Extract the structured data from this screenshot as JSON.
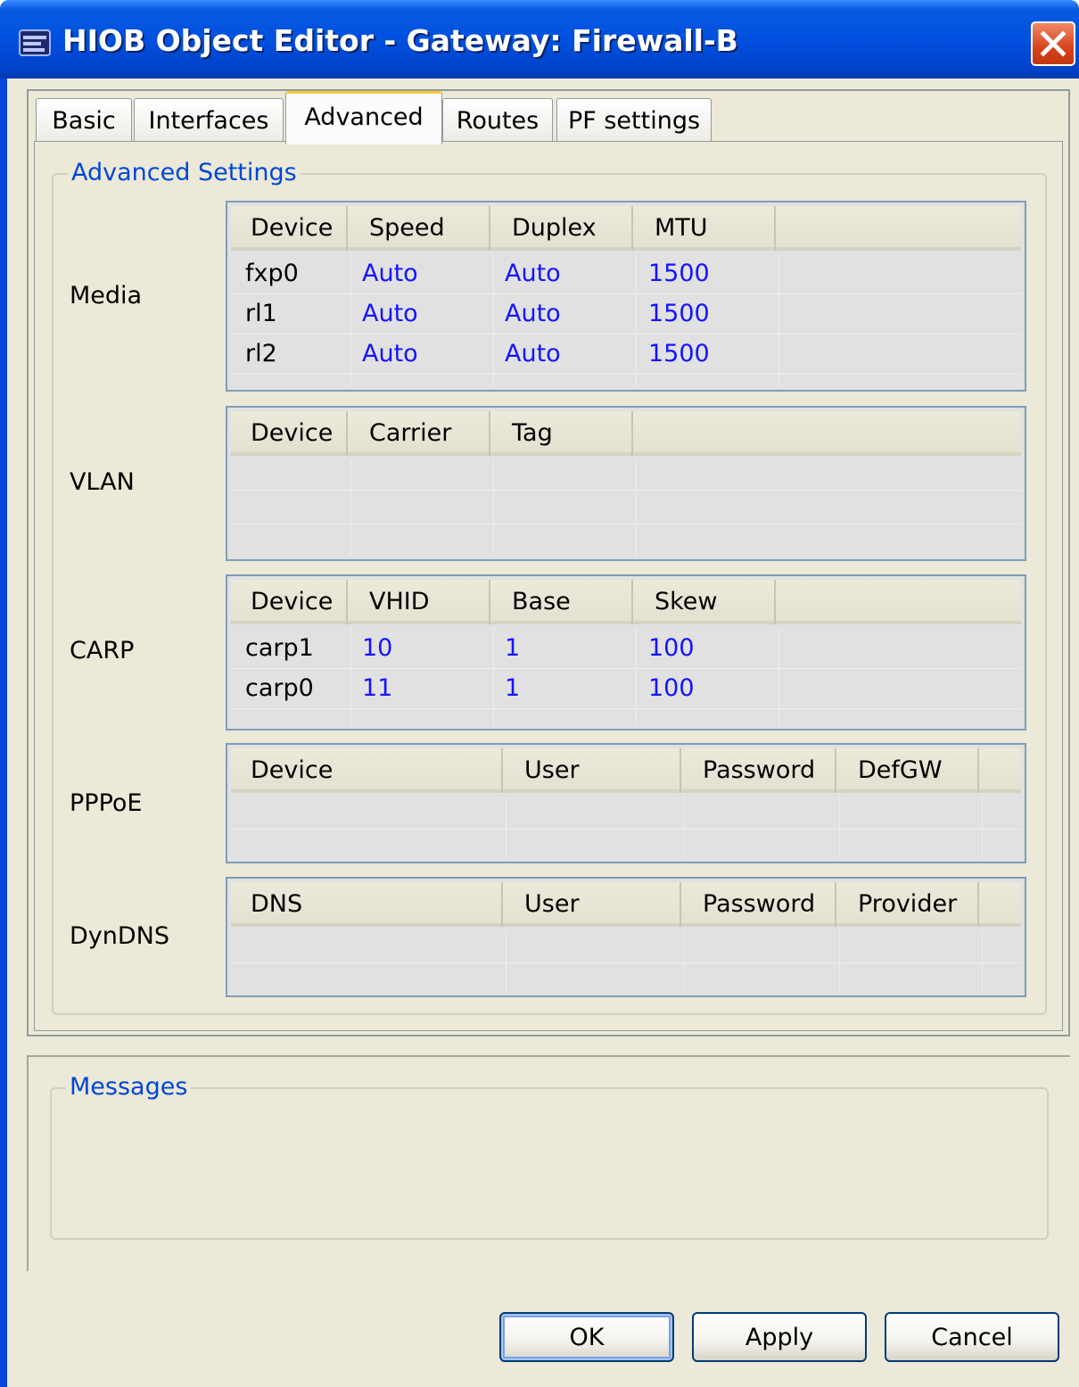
{
  "window": {
    "title": "HIOB Object Editor - Gateway: Firewall-B",
    "icon": "hiob-app-icon",
    "close_icon": "close-icon"
  },
  "tabs": [
    {
      "label": "Basic",
      "active": false
    },
    {
      "label": "Interfaces",
      "active": false
    },
    {
      "label": "Advanced",
      "active": true
    },
    {
      "label": "Routes",
      "active": false
    },
    {
      "label": "PF settings",
      "active": false
    }
  ],
  "advanced": {
    "legend": "Advanced Settings",
    "media": {
      "label": "Media",
      "columns": [
        "Device",
        "Speed",
        "Duplex",
        "MTU"
      ],
      "rows": [
        [
          "fxp0",
          "Auto",
          "Auto",
          "1500"
        ],
        [
          "rl1",
          "Auto",
          "Auto",
          "1500"
        ],
        [
          "rl2",
          "Auto",
          "Auto",
          "1500"
        ]
      ]
    },
    "vlan": {
      "label": "VLAN",
      "columns": [
        "Device",
        "Carrier",
        "Tag"
      ],
      "rows": []
    },
    "carp": {
      "label": "CARP",
      "columns": [
        "Device",
        "VHID",
        "Base",
        "Skew"
      ],
      "rows": [
        [
          "carp1",
          "10",
          "1",
          "100"
        ],
        [
          "carp0",
          "11",
          "1",
          "100"
        ]
      ]
    },
    "pppoe": {
      "label": "PPPoE",
      "columns": [
        "Device",
        "User",
        "Password",
        "DefGW"
      ],
      "rows": []
    },
    "dyndns": {
      "label": "DynDNS",
      "columns": [
        "DNS",
        "User",
        "Password",
        "Provider"
      ],
      "rows": []
    }
  },
  "messages": {
    "legend": "Messages",
    "text": ""
  },
  "buttons": {
    "ok": "OK",
    "apply": "Apply",
    "cancel": "Cancel"
  },
  "colors": {
    "titlebar": "#0050e0",
    "legend_text": "#0046d5",
    "editable_value": "#1414ff",
    "dialog_bg": "#ece9d8"
  }
}
